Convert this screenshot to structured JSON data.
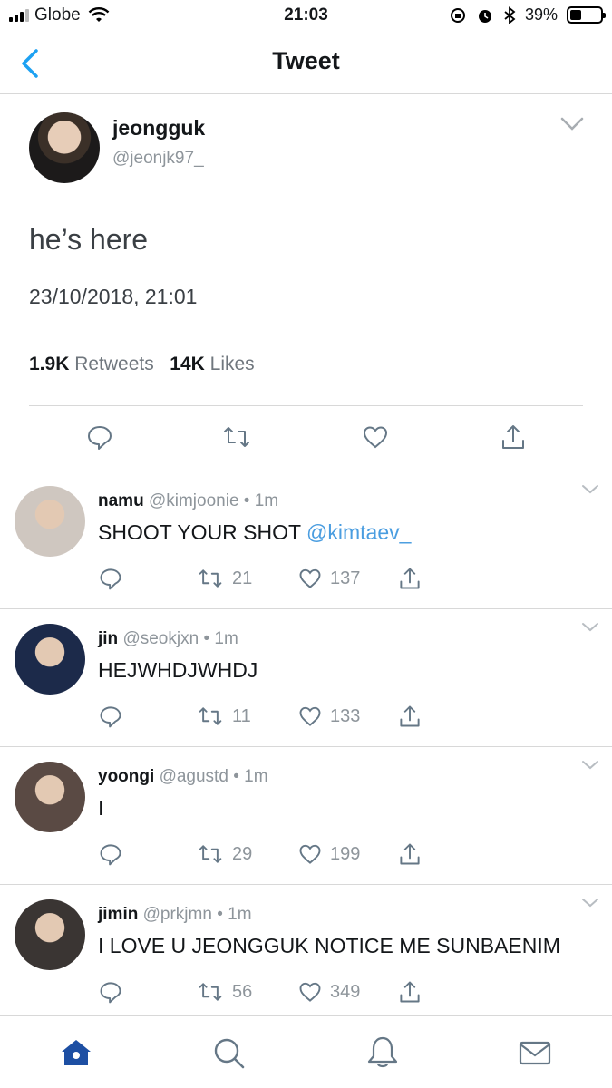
{
  "status_bar": {
    "carrier": "Globe",
    "time": "21:03",
    "battery": "39%",
    "battery_level": 0.39
  },
  "nav": {
    "title": "Tweet",
    "back_icon": "chevron-left-icon"
  },
  "main_tweet": {
    "name": "jeongguk",
    "handle": "@jeonjk97_",
    "text": "he’s here",
    "timestamp": "23/10/2018, 21:01",
    "retweets_count": "1.9K",
    "retweets_label": "Retweets",
    "likes_count": "14K",
    "likes_label": "Likes"
  },
  "replies": [
    {
      "name": "namu",
      "handle": "@kimjoonie",
      "time": "1m",
      "text": "SHOOT YOUR SHOT ",
      "mention": "@kimtaev_",
      "retweets": "21",
      "likes": "137",
      "avatar_color": "#cfc7c0"
    },
    {
      "name": "jin",
      "handle": "@seokjxn",
      "time": "1m",
      "text": "HEJWHDJWHDJ",
      "mention": "",
      "retweets": "11",
      "likes": "133",
      "avatar_color": "#1c2a4a"
    },
    {
      "name": "yoongi",
      "handle": "@agustd",
      "time": "1m",
      "text": "I",
      "mention": "",
      "retweets": "29",
      "likes": "199",
      "avatar_color": "#5a4a44"
    },
    {
      "name": "jimin",
      "handle": "@prkjmn",
      "time": "1m",
      "text": "I LOVE U JEONGGUK NOTICE ME SUNBAENIM",
      "mention": "",
      "retweets": "56",
      "likes": "349",
      "avatar_color": "#3a3533"
    }
  ],
  "tabbar": {
    "items": [
      "home-icon",
      "search-icon",
      "bell-icon",
      "mail-icon"
    ],
    "active_color": "#1d4fa3"
  },
  "colors": {
    "link": "#4a9de0",
    "muted": "#8e959b",
    "accent": "#1da1f2"
  }
}
